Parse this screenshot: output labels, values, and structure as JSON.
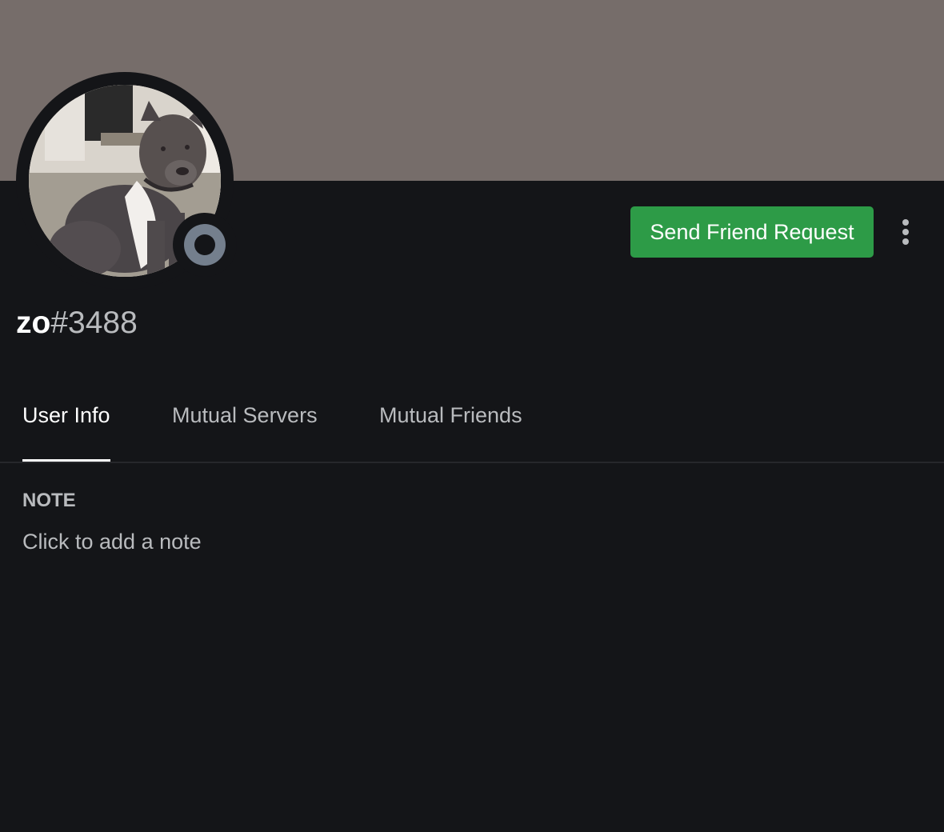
{
  "colors": {
    "banner": "#766d6a",
    "background": "#141518",
    "accent_button": "#2d9b47",
    "status_offline": "#747f8d",
    "text_primary": "#ffffff",
    "text_secondary": "#b9bbbe"
  },
  "profile": {
    "username": "zo",
    "discriminator": "#3488",
    "status": "offline",
    "avatar_icon": "dog-photo"
  },
  "actions": {
    "send_friend_request": "Send Friend Request",
    "more_icon": "vertical-ellipsis-icon"
  },
  "tabs": [
    {
      "label": "User Info",
      "active": true
    },
    {
      "label": "Mutual Servers",
      "active": false
    },
    {
      "label": "Mutual Friends",
      "active": false
    }
  ],
  "note": {
    "heading": "NOTE",
    "placeholder": "Click to add a note"
  }
}
